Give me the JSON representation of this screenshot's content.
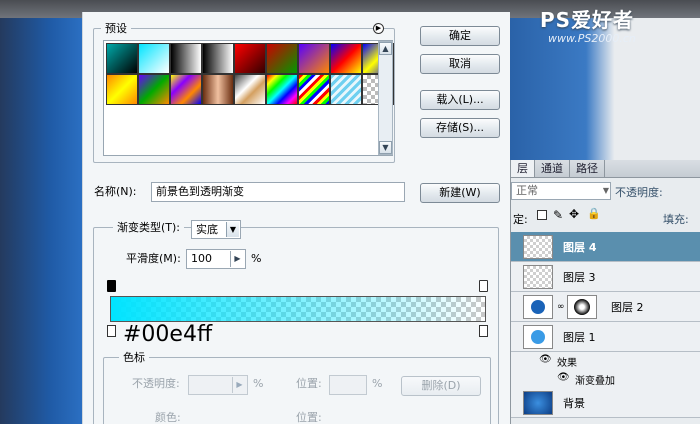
{
  "dialog": {
    "presets_label": "预设",
    "buttons": {
      "ok": "确定",
      "cancel": "取消",
      "load": "载入(L)...",
      "save": "存储(S)...",
      "new": "新建(W)"
    },
    "name_label": "名称(N):",
    "name_value": "前景色到透明渐变",
    "gradient_type_label": "渐变类型(T):",
    "gradient_type_value": "实底",
    "smoothness_label": "平滑度(M):",
    "smoothness_value": "100",
    "smoothness_unit": "%",
    "gradient_color": "#00e4ff",
    "stops_group_label": "色标",
    "opacity_label": "不透明度:",
    "opacity_unit": "%",
    "location_label": "位置:",
    "location_unit": "%",
    "delete_label": "删除(D)",
    "color_label": "颜色:",
    "presets": [
      {
        "name": "cyan-black",
        "css": "linear-gradient(135deg,#0aa 0%,#000 100%)"
      },
      {
        "name": "cyan-transparent",
        "css": "linear-gradient(135deg,#00e4ff 0%,rgba(0,228,255,0) 100%)"
      },
      {
        "name": "black-white",
        "css": "linear-gradient(90deg,#000 0%,#fff 100%)"
      },
      {
        "name": "black-transparent",
        "css": "linear-gradient(90deg,#000 0%,rgba(0,0,0,0) 100%)"
      },
      {
        "name": "red-black",
        "css": "linear-gradient(135deg,#f00 0%,#300 100%)"
      },
      {
        "name": "red-green",
        "css": "linear-gradient(135deg,#c00 0%,#090 100%)"
      },
      {
        "name": "violet-orange",
        "css": "linear-gradient(135deg,#50f 0%,#f80 100%)"
      },
      {
        "name": "blue-red-yellow",
        "css": "linear-gradient(135deg,#00f 0%,#f00 50%,#ff0 100%)"
      },
      {
        "name": "blue-yellow-blue",
        "css": "linear-gradient(135deg,#00f 0%,#ff0 50%,#00f 100%)"
      },
      {
        "name": "orange-yellow-orange",
        "css": "linear-gradient(135deg,#f80 0%,#ff0 50%,#f80 100%)"
      },
      {
        "name": "violet-green-orange",
        "css": "linear-gradient(135deg,#60f 0%,#0a0 50%,#f80 100%)"
      },
      {
        "name": "yellow-violet-orange-blue",
        "css": "linear-gradient(135deg,#ff0 0%,#80f 33%,#f80 66%,#00f 100%)"
      },
      {
        "name": "copper",
        "css": "linear-gradient(90deg,#6a2d10 0%,#f0c0a0 50%,#6a2d10 100%)"
      },
      {
        "name": "chrome",
        "css": "linear-gradient(135deg,#444 0%,#fff 40%,#d4a060 60%,#fff 100%)"
      },
      {
        "name": "spectrum",
        "css": "linear-gradient(135deg,#f00,#ff0,#0f0,#0ff,#00f,#f0f,#f00)"
      },
      {
        "name": "transparent-rainbow",
        "css": "repeating-linear-gradient(135deg,#f00 0 3px,#ff0 3px 6px,#0f0 6px 9px,#00f 9px 12px,#fff 12px 15px)"
      },
      {
        "name": "transparent-stripes",
        "css": "repeating-linear-gradient(135deg,#6fd0f0 0 3px,#e9f7fc 3px 6px)"
      },
      {
        "name": "neutral-density",
        "css": "repeating-conic-gradient(#bbb 0% 25%, #fff 0% 50%) 0 0 / 8px 8px"
      }
    ]
  },
  "layers_panel": {
    "tabs": [
      "层",
      "通道",
      "路径"
    ],
    "blend_mode": "正常",
    "opacity_label": "不透明度:",
    "lock_label": "定:",
    "fill_label": "填充:",
    "layers": [
      {
        "name": "图层 4",
        "selected": true
      },
      {
        "name": "图层 3",
        "selected": false
      },
      {
        "name": "图层 2",
        "selected": false
      },
      {
        "name": "图层 1",
        "selected": false
      }
    ],
    "effects_label": "效果",
    "effect_item": "渐变叠加",
    "background_label": "背景"
  },
  "watermark": {
    "logo": "PS爱好者",
    "url": "www.PS2000.cn"
  }
}
